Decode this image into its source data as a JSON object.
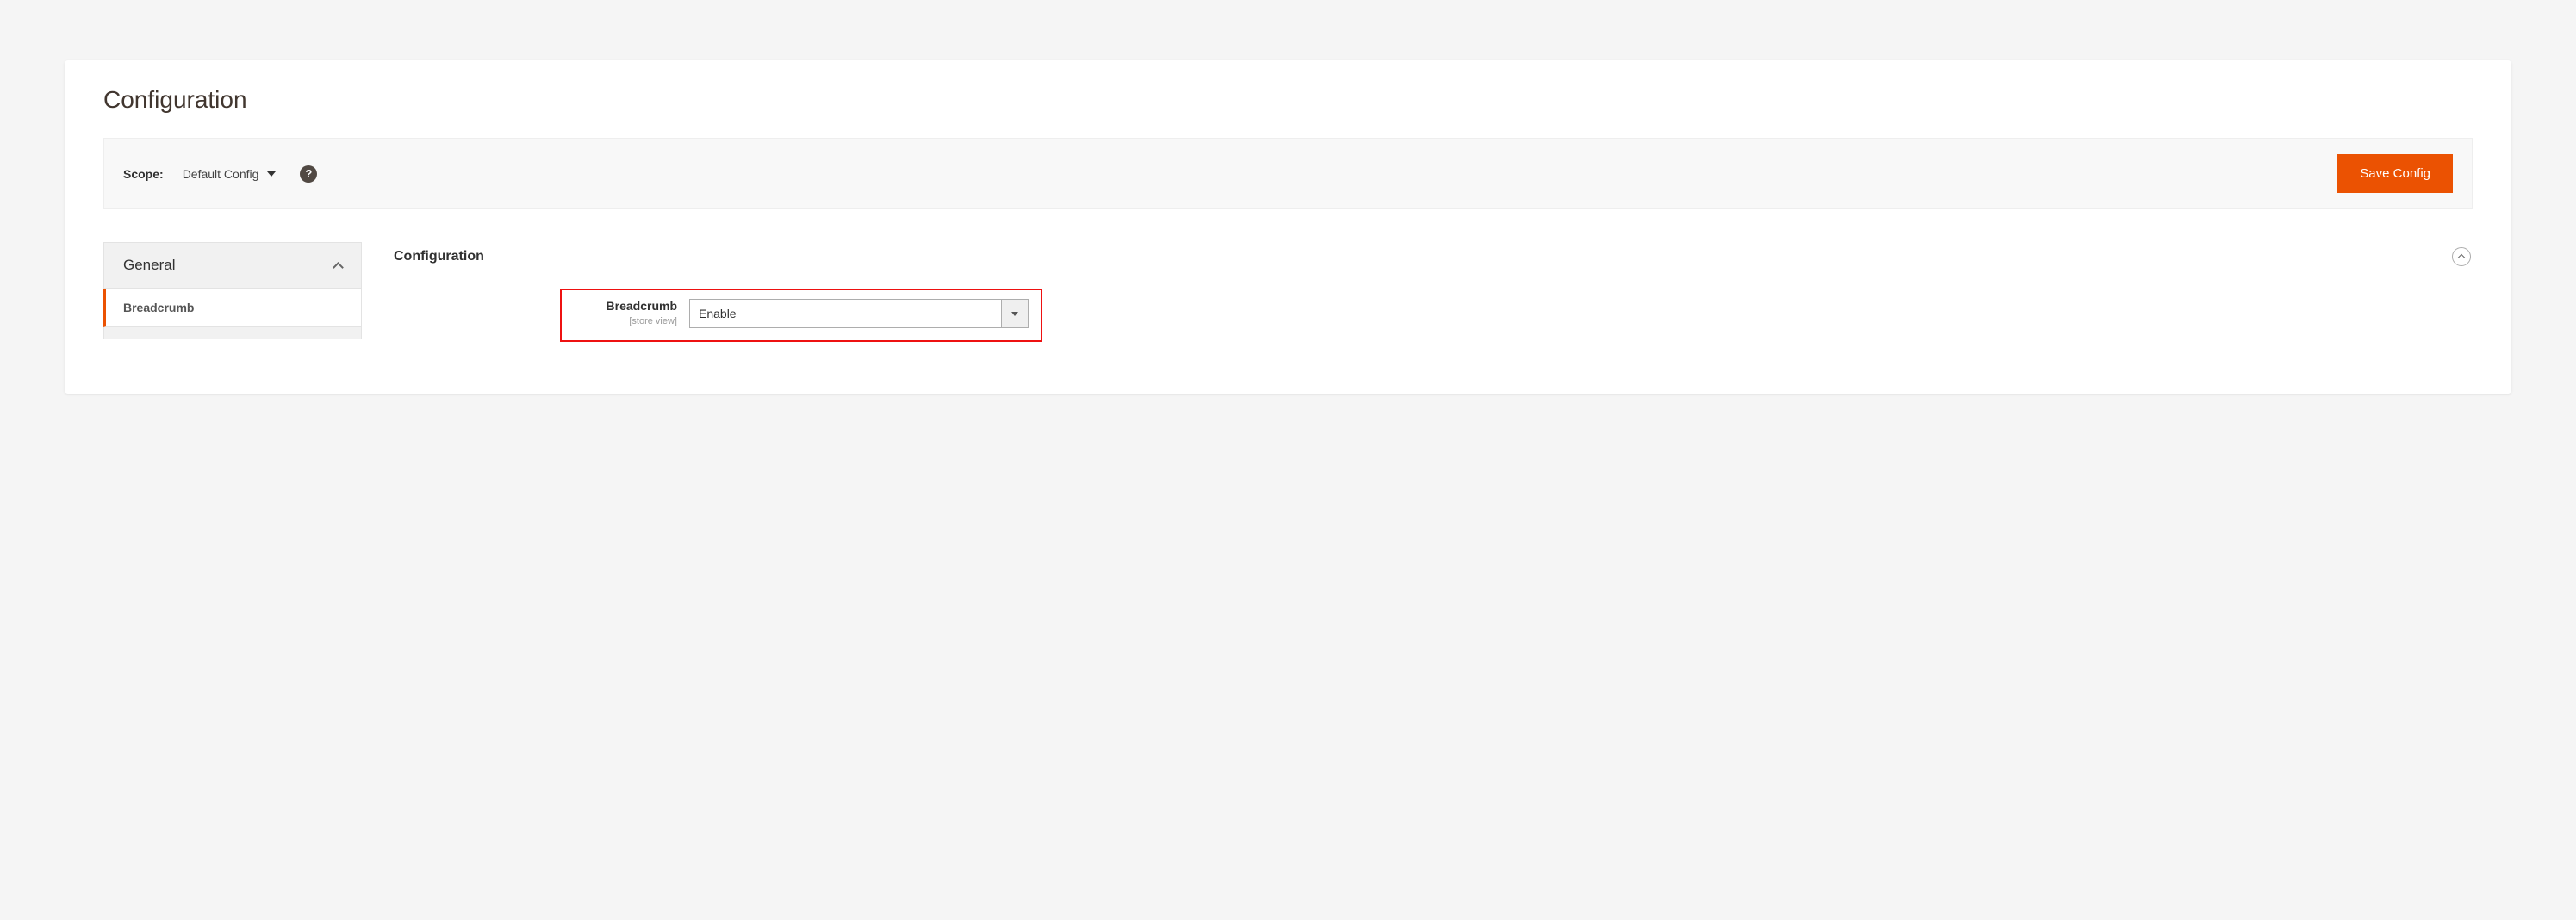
{
  "page": {
    "title": "Configuration"
  },
  "scope_bar": {
    "label": "Scope:",
    "selected": "Default Config",
    "save_label": "Save Config"
  },
  "sidebar": {
    "section": "General",
    "items": [
      {
        "label": "Breadcrumb"
      }
    ]
  },
  "group": {
    "title": "Configuration"
  },
  "field": {
    "label": "Breadcrumb",
    "scope_note": "[store view]",
    "value": "Enable"
  },
  "colors": {
    "accent": "#eb5202",
    "highlight": "#e11"
  }
}
